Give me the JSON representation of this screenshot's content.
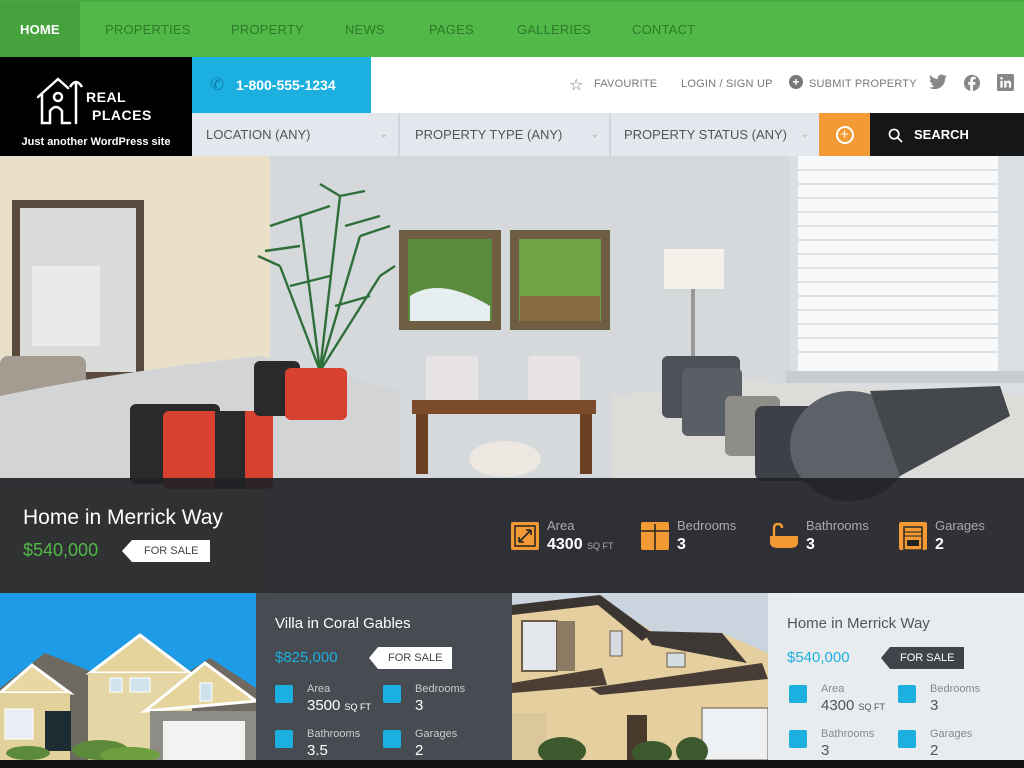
{
  "nav": {
    "items": [
      {
        "label": "HOME",
        "active": true
      },
      {
        "label": "PROPERTIES"
      },
      {
        "label": "PROPERTY"
      },
      {
        "label": "NEWS"
      },
      {
        "label": "PAGES"
      },
      {
        "label": "GALLERIES"
      },
      {
        "label": "CONTACT"
      }
    ]
  },
  "brand": {
    "name_line1": "REAL",
    "name_line2": "PLACES",
    "tagline": "Just another WordPress site"
  },
  "header": {
    "phone": "1-800-555-1234",
    "favourite": "FAVOURITE",
    "login": "LOGIN / SIGN UP",
    "submit": "SUBMIT PROPERTY",
    "social": [
      "twitter-icon",
      "facebook-icon",
      "linkedin-icon"
    ]
  },
  "search": {
    "location": "LOCATION (ANY)",
    "type": "PROPERTY TYPE (ANY)",
    "status": "PROPERTY STATUS (ANY)",
    "button": "SEARCH"
  },
  "hero": {
    "title": "Home in Merrick Way",
    "price": "$540,000",
    "status": "FOR SALE",
    "features": [
      {
        "label": "Area",
        "value": "4300",
        "unit": "SQ FT",
        "icon": "area-icon"
      },
      {
        "label": "Bedrooms",
        "value": "3",
        "icon": "bedroom-icon"
      },
      {
        "label": "Bathrooms",
        "value": "3",
        "icon": "bathtub-icon"
      },
      {
        "label": "Garages",
        "value": "2",
        "icon": "garage-icon"
      }
    ]
  },
  "cards": [
    {
      "title": "Villa in Coral Gables",
      "price": "$825,000",
      "status": "FOR SALE",
      "area": "3500",
      "area_unit": "SQ FT",
      "bedrooms": "3",
      "bathrooms": "3.5",
      "garages": "2"
    },
    {
      "title": "Home in Merrick Way",
      "price": "$540,000",
      "status": "FOR SALE",
      "area": "4300",
      "area_unit": "SQ FT",
      "bedrooms": "3",
      "bathrooms": "3",
      "garages": "2"
    }
  ],
  "labels": {
    "area": "Area",
    "bedrooms": "Bedrooms",
    "bathrooms": "Bathrooms",
    "garages": "Garages"
  },
  "colors": {
    "nav_green": "#52b848",
    "phone_blue": "#1cb0e0",
    "accent_orange": "#f39a35",
    "price_green": "#52b848",
    "price_blue": "#1cb0e0"
  }
}
